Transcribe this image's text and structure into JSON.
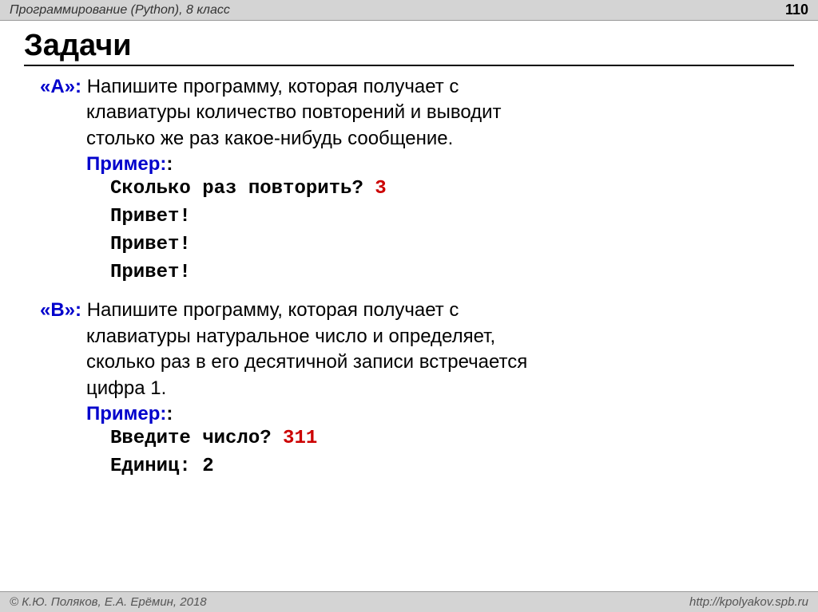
{
  "header": {
    "title": "Программирование (Python), 8 класс",
    "page_number": "110"
  },
  "main_title": "Задачи",
  "tasks": {
    "a": {
      "label": "«А»:",
      "text_line1": "Напишите программу, которая получает с",
      "text_line2": "клавиатуры количество повторений и выводит",
      "text_line3": "столько же раз какое-нибудь сообщение.",
      "example_label": "Пример:",
      "prompt": "Сколько раз повторить? ",
      "input": "3",
      "output1": "Привет!",
      "output2": "Привет!",
      "output3": "Привет!"
    },
    "b": {
      "label": "«B»:",
      "text_line1": "Напишите программу, которая получает с",
      "text_line2": "клавиатуры натуральное число и определяет,",
      "text_line3": "сколько  раз в его десятичной записи встречается",
      "text_line4": "цифра 1.",
      "example_label": "Пример:",
      "prompt": "Введите число? ",
      "input": "311",
      "output1": "Единиц: 2"
    }
  },
  "footer": {
    "left": "© К.Ю. Поляков, Е.А. Ерёмин, 2018",
    "right": "http://kpolyakov.spb.ru"
  }
}
